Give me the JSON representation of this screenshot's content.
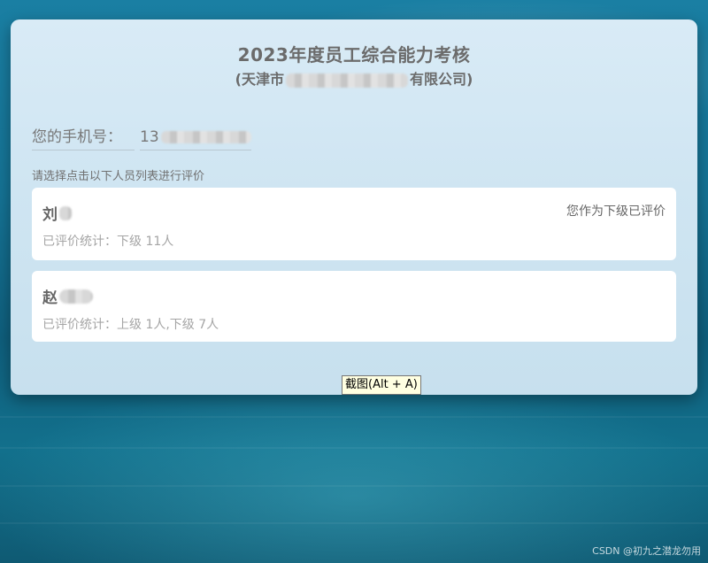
{
  "header": {
    "title": "2023年度员工综合能力考核",
    "subtitle_prefix": "(天津市",
    "subtitle_suffix": "有限公司)"
  },
  "phone": {
    "label": "您的手机号：",
    "value_prefix": "13"
  },
  "hint": "请选择点击以下人员列表进行评价",
  "people": [
    {
      "name_prefix": "刘",
      "status": "您作为下级已评价",
      "stats": "已评价统计：下级 11人"
    },
    {
      "name_prefix": "赵",
      "status": "",
      "stats": "已评价统计：上级 1人,下级 7人"
    }
  ],
  "tooltip": "截图(Alt + A)",
  "watermark": "CSDN @初九之潜龙勿用"
}
